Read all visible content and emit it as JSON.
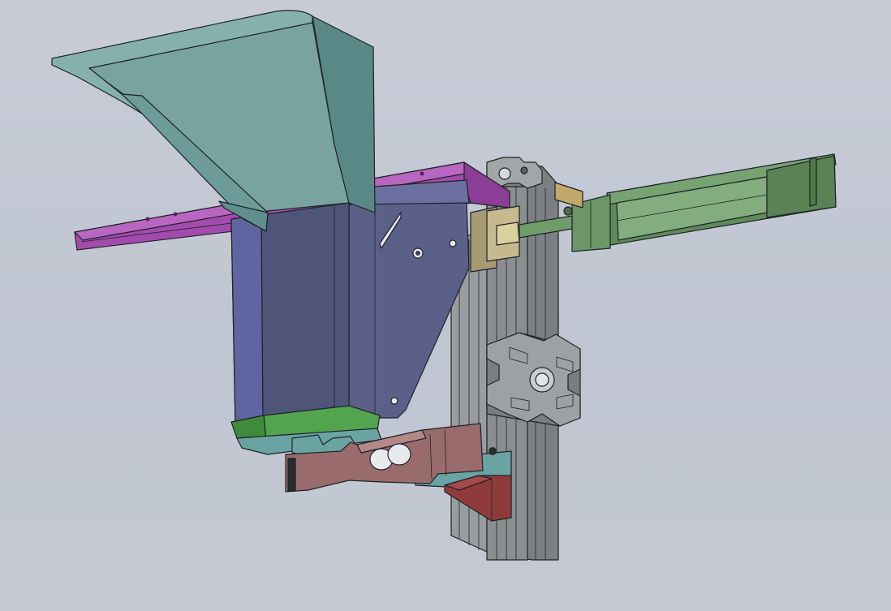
{
  "scene": {
    "background": "#c4c9d3",
    "parts": [
      {
        "name": "hopper",
        "color": "#6f9b98"
      },
      {
        "name": "magenta-rail",
        "color": "#a24bad"
      },
      {
        "name": "chute-bracket",
        "color": "#555a82"
      },
      {
        "name": "tray-floor",
        "color": "#52a44e"
      },
      {
        "name": "aluminum-extrusion-profile",
        "color": "#8a8d90"
      },
      {
        "name": "linear-actuator",
        "color": "#6c9666"
      },
      {
        "name": "shaft-coupler",
        "color": "#a89a73"
      },
      {
        "name": "load-cell",
        "color": "#9a6b6c"
      },
      {
        "name": "mount-block",
        "color": "#8f3b3b"
      },
      {
        "name": "teal-clip",
        "color": "#6aa3a2"
      }
    ]
  }
}
